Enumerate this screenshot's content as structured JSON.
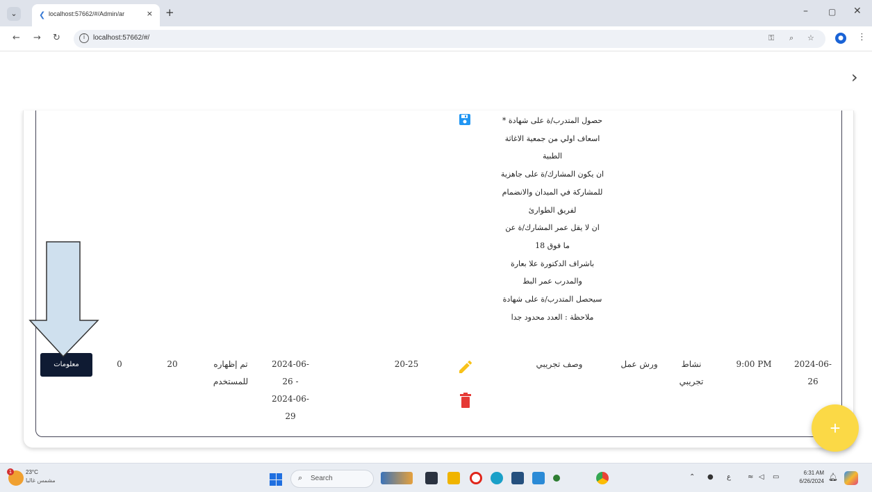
{
  "browser": {
    "tab_title": "localhost:57662/#/Admin/ar",
    "url": "localhost:57662/#/",
    "new_tab_label": "+",
    "tab_close_label": "×",
    "minimize_label": "–",
    "maximize_label": "▢",
    "close_label": "✕"
  },
  "description_lines": [
    "حصول المتدرب/ة على شهادة *",
    "اسعاف اولي من جمعية الاغاثة",
    "الطبية",
    "ان يكون المشارك/ة على جاهزية",
    "للمشاركة في الميدان  والانضمام",
    "لفريق الطوارئ",
    "ان لا يقل عمر المشارك/ة عن",
    "ما فوق 18",
    "باشراف الدكتورة علا بعارة",
    "والمدرب عمر البط",
    "سيحصل المتدرب/ة على شهادة",
    "ملاحظة : العدد محدود جدا"
  ],
  "row": {
    "date_line1": "2024-06-",
    "date_line2": "26",
    "time": "9:00 PM",
    "activity_line1": "نشاط",
    "activity_line2": "تجريبي",
    "type": "ورش عمل",
    "description": "وصف تجريبي",
    "age_range": "20-25",
    "period_line1": "2024-06-",
    "period_line2": "26 -",
    "period_line3": "2024-06-",
    "period_line4": "29",
    "status_line1": "تم إظهاره",
    "status_line2": "للمستخدم",
    "capacity": "20",
    "registered": "0",
    "info_button_label": "معلومات"
  },
  "fab_label": "+",
  "taskbar": {
    "weather_temp": "23°C",
    "weather_desc": "مشمس غالبا",
    "weather_badge": "1",
    "search_label": "Search",
    "clock_time": "6:31 AM",
    "clock_date": "6/26/2024"
  },
  "colors": {
    "accent_blue": "#2196f3",
    "edit_yellow": "#f8c21a",
    "delete_red": "#e53935",
    "info_button_bg": "#0f1b33",
    "fab_yellow": "#fbd946",
    "arrow_fill": "#cfe0ee"
  }
}
